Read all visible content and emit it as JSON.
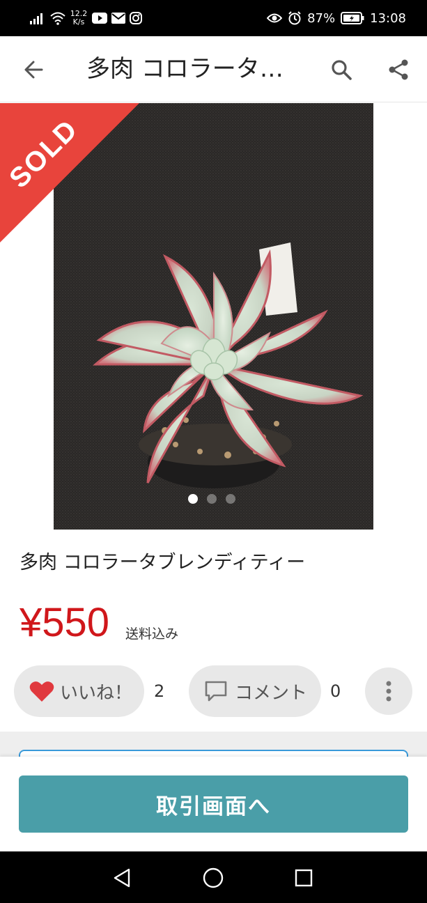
{
  "status_bar": {
    "net_speed_value": "12.2",
    "net_speed_unit": "K/s",
    "battery": "87%",
    "time": "13:08",
    "icons": [
      "signal-icon",
      "wifi-icon",
      "youtube-icon",
      "mail-icon",
      "instagram-icon",
      "eye-icon",
      "alarm-icon",
      "battery-icon"
    ]
  },
  "app_bar": {
    "title": "多肉 コロラータブレンディティー",
    "icons": [
      "back-arrow-icon",
      "search-icon",
      "share-icon"
    ]
  },
  "carousel": {
    "badge": "SOLD",
    "badge_color": "#e8443c",
    "image_count": 3,
    "active_index": 0
  },
  "item": {
    "title": "多肉 コロラータブレンディティー",
    "price": "¥550",
    "price_color": "#d0171b",
    "shipping_note": "送料込み"
  },
  "actions": {
    "like_label": "いいね！",
    "like_count": "2",
    "comment_label": "コメント",
    "comment_count": "0"
  },
  "bottom": {
    "trade_button_label": "取引画面へ",
    "button_color": "#4a9ea8"
  },
  "nav": {
    "icons": [
      "nav-back-icon",
      "nav-home-icon",
      "nav-recents-icon"
    ]
  }
}
